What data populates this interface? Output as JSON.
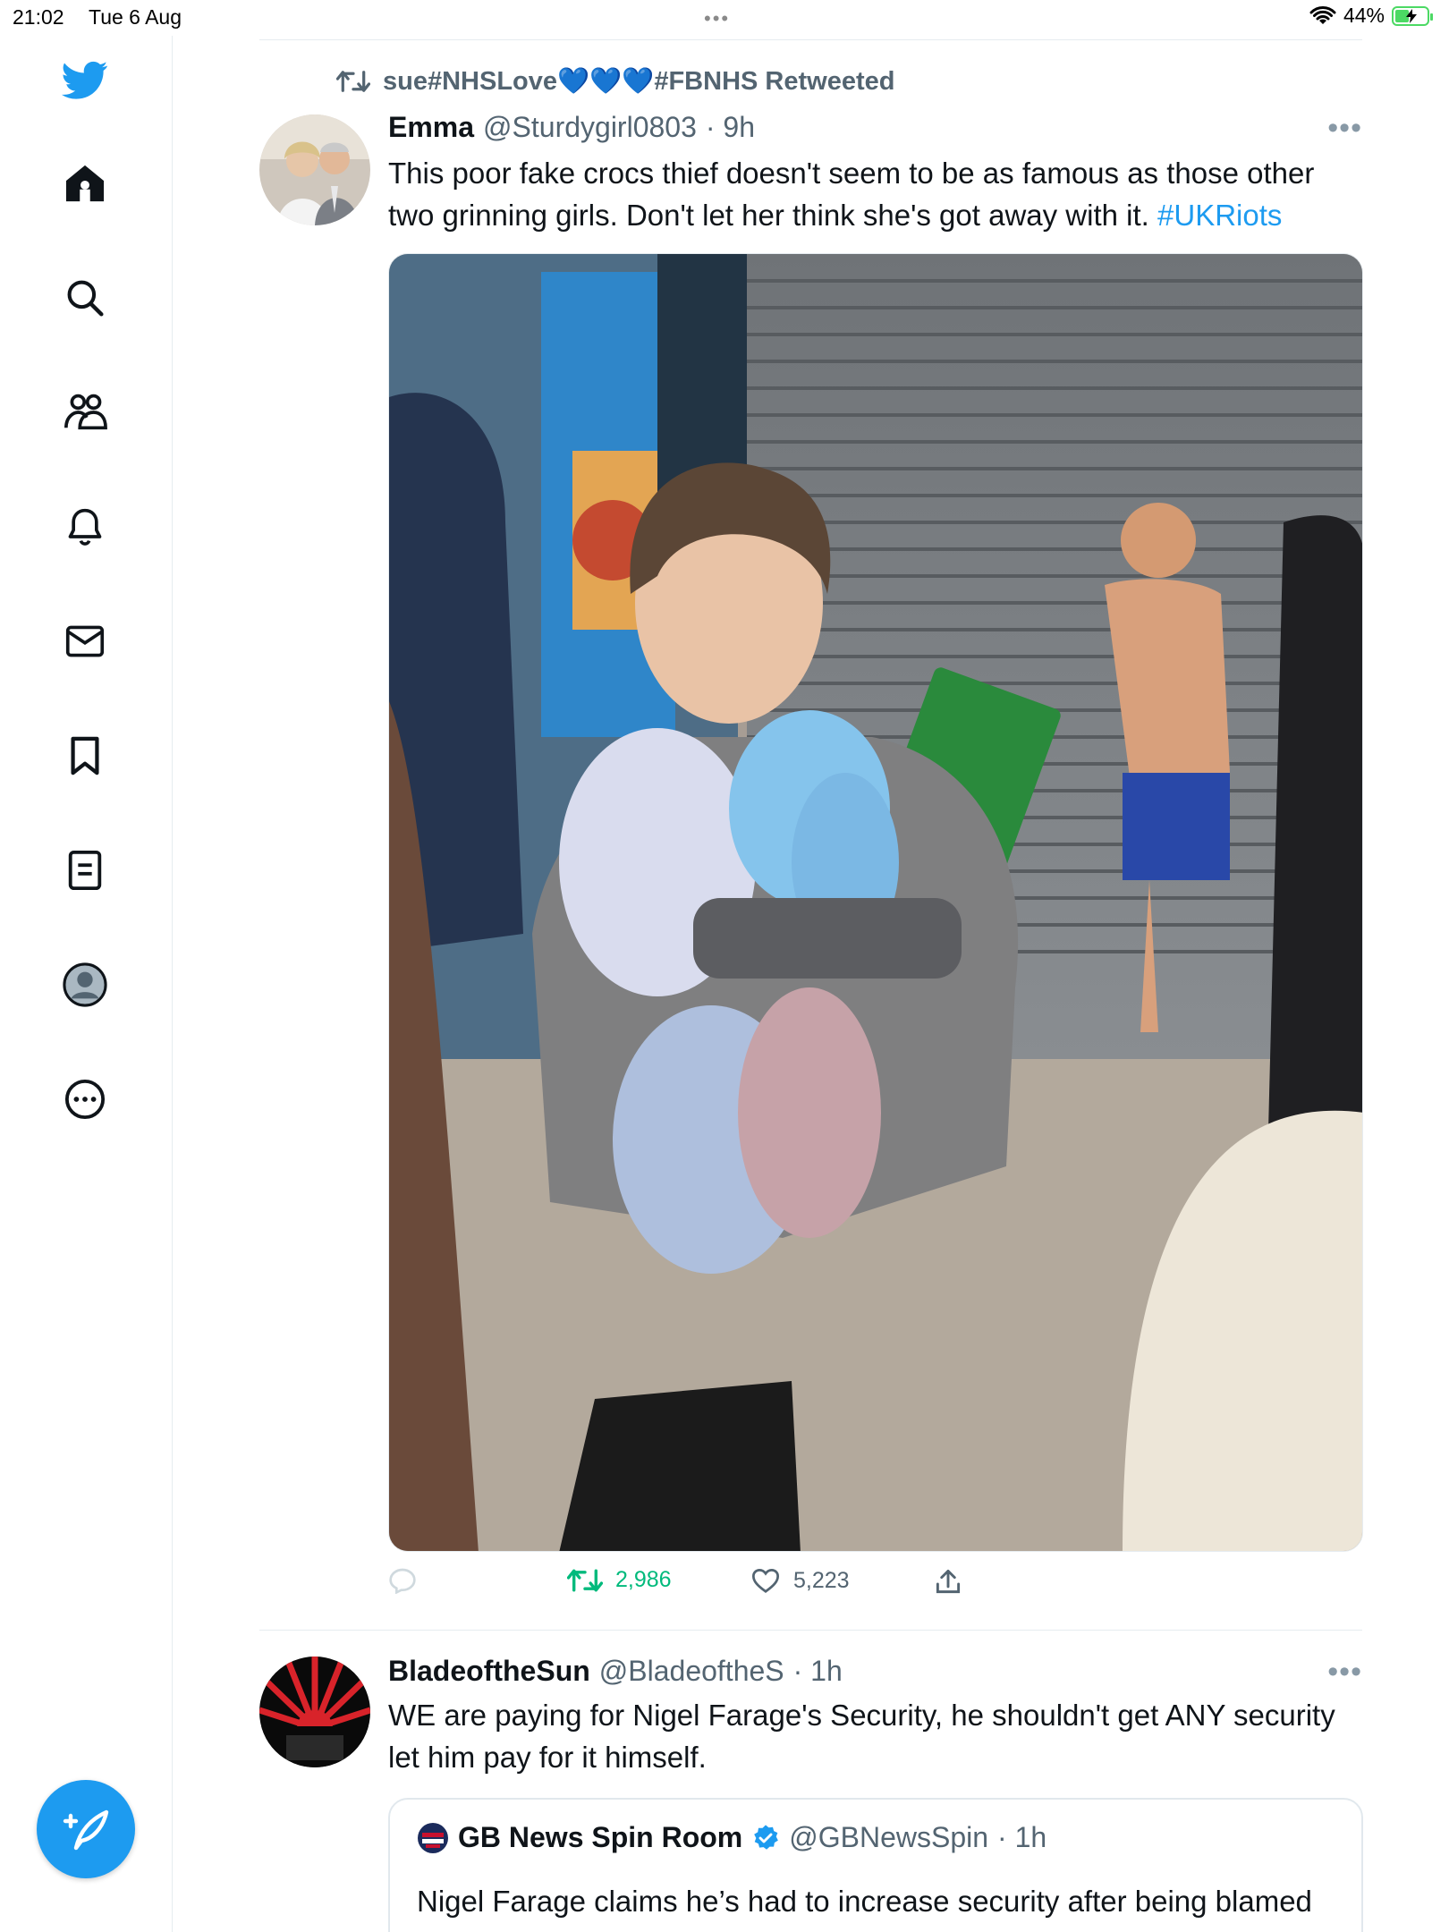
{
  "status_bar": {
    "time": "21:02",
    "date": "Tue 6 Aug",
    "battery": "44%",
    "battery_level": 0.44,
    "dots": "•••"
  },
  "sidebar": {
    "items": [
      {
        "name": "home",
        "icon": "home-icon"
      },
      {
        "name": "explore",
        "icon": "search-icon"
      },
      {
        "name": "communities",
        "icon": "people-icon"
      },
      {
        "name": "notifications",
        "icon": "bell-icon"
      },
      {
        "name": "messages",
        "icon": "mail-icon"
      },
      {
        "name": "bookmarks",
        "icon": "bookmark-icon"
      },
      {
        "name": "lists",
        "icon": "list-icon"
      },
      {
        "name": "profile",
        "icon": "avatar-icon"
      },
      {
        "name": "more",
        "icon": "more-circle-icon"
      }
    ],
    "compose_icon": "compose-icon",
    "brand_color": "#1d9bf0"
  },
  "tweets": [
    {
      "retweeted_by": "sue#NHSLove💙💙💙#FBNHS Retweeted",
      "name": "Emma",
      "handle": "@Sturdygirl0803",
      "time": "· 9h",
      "text": "This poor fake crocs thief doesn't seem to be as famous as those other two grinning girls. Don't let her think she's got away with it.",
      "hashtag": "#UKRiots",
      "more": "•••",
      "replies": "",
      "retweets": "2,986",
      "likes": "5,223"
    },
    {
      "name": "BladeoftheSun",
      "handle": "@BladeoftheS",
      "time": "· 1h",
      "text": "WE are paying for Nigel Farage's Security, he shouldn't get ANY security let him pay for it himself.",
      "more": "•••",
      "quote": {
        "name": "GB News Spin Room",
        "handle": "@GBNewsSpin",
        "time": "· 1h",
        "text": "Nigel Farage claims he’s had to increase security after being blamed for inciting the widespread rioting"
      }
    }
  ],
  "colors": {
    "accent": "#1d9bf0",
    "retweet_green": "#00ba7c",
    "muted": "#536471"
  }
}
